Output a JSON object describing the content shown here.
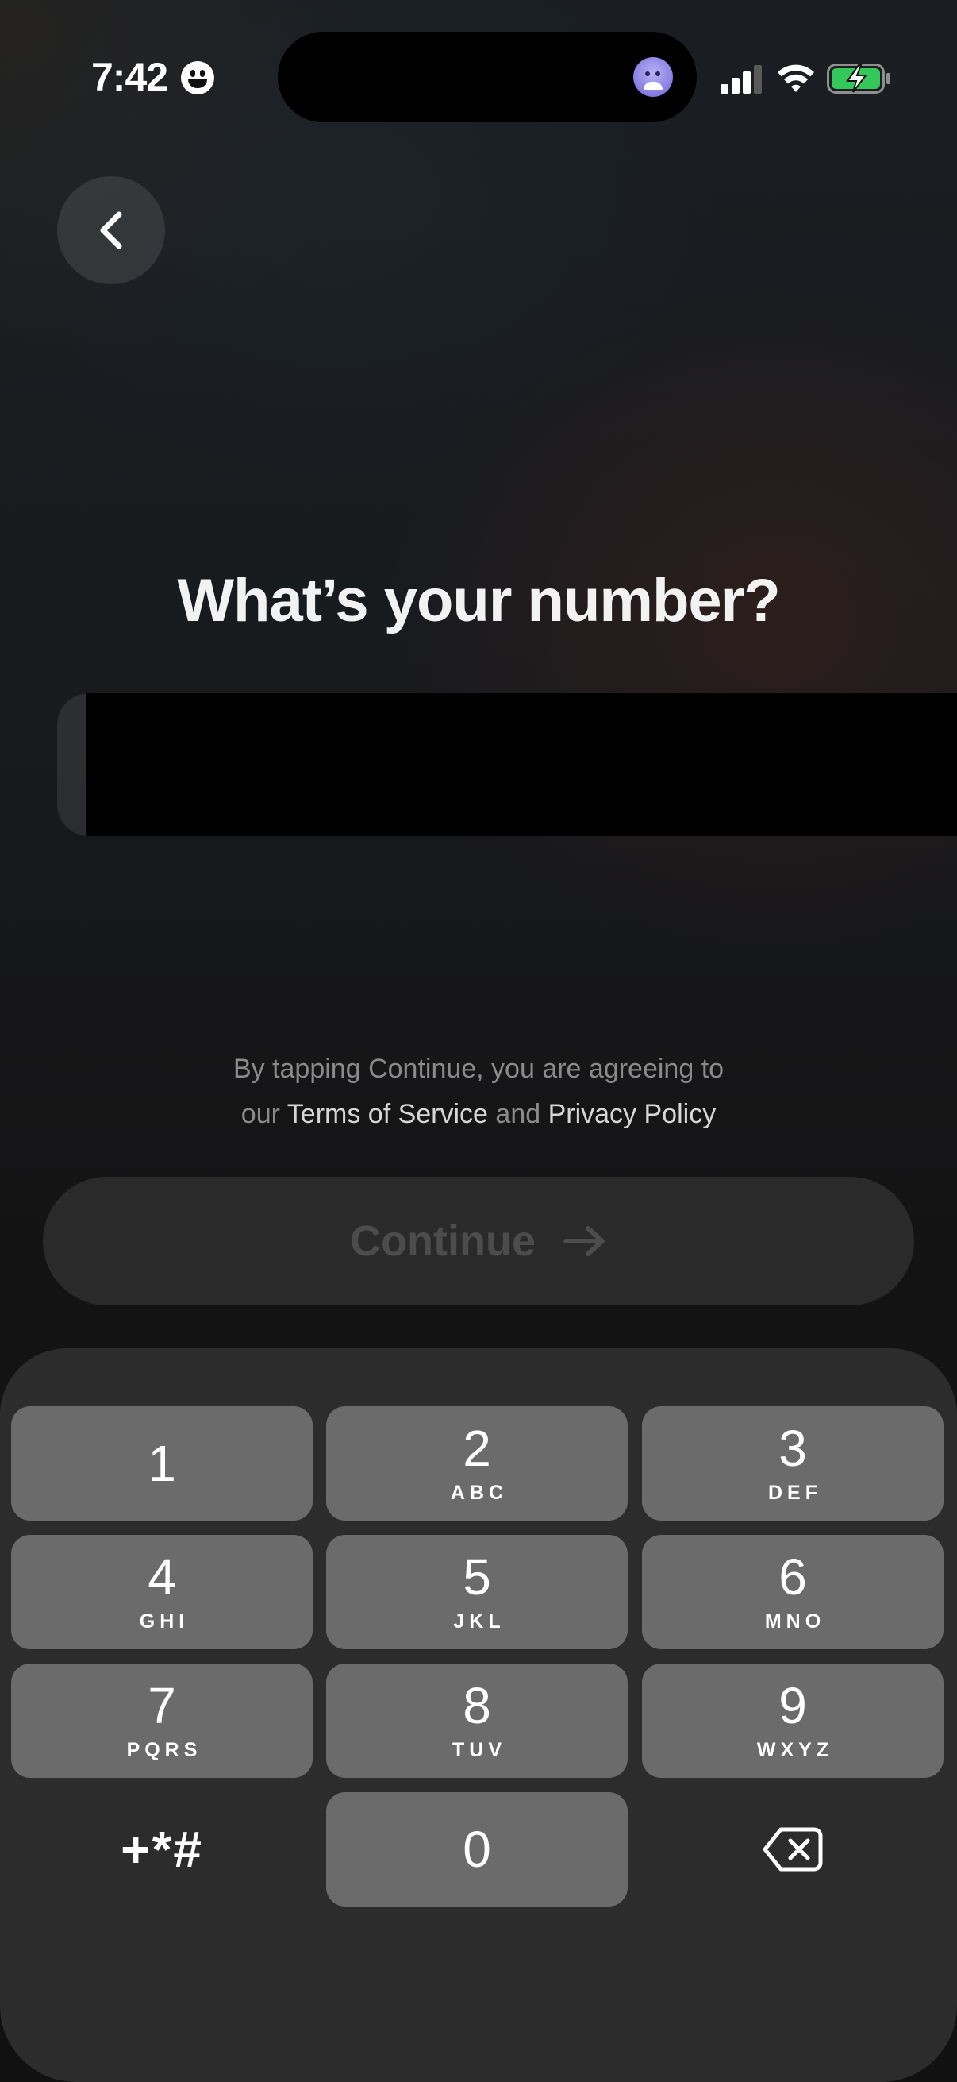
{
  "status_bar": {
    "time": "7:42"
  },
  "header": {
    "title": "What’s your number?"
  },
  "terms": {
    "line1": "By tapping Continue, you are agreeing to",
    "prefix": "our ",
    "tos": "Terms of Service",
    "and": " and ",
    "privacy": "Privacy Policy"
  },
  "continue_button": {
    "label": "Continue"
  },
  "keypad": {
    "keys": [
      {
        "digit": "1",
        "letters": ""
      },
      {
        "digit": "2",
        "letters": "ABC"
      },
      {
        "digit": "3",
        "letters": "DEF"
      },
      {
        "digit": "4",
        "letters": "GHI"
      },
      {
        "digit": "5",
        "letters": "JKL"
      },
      {
        "digit": "6",
        "letters": "MNO"
      },
      {
        "digit": "7",
        "letters": "PQRS"
      },
      {
        "digit": "8",
        "letters": "TUV"
      },
      {
        "digit": "9",
        "letters": "WXYZ"
      },
      {
        "digit": "+*#",
        "letters": ""
      },
      {
        "digit": "0",
        "letters": ""
      },
      {
        "digit": "",
        "letters": ""
      }
    ]
  },
  "icons": {
    "back": "chevron-left-icon",
    "continue_arrow": "arrow-right-icon",
    "delete": "backspace-icon",
    "signal": "cellular-signal-icon",
    "wifi": "wifi-icon",
    "battery": "battery-charging-icon"
  },
  "colors": {
    "battery_green": "#34c759",
    "key_background": "#6b6b6b",
    "keypad_background": "#2c2c2c",
    "continue_disabled": "#2a2a2b"
  }
}
